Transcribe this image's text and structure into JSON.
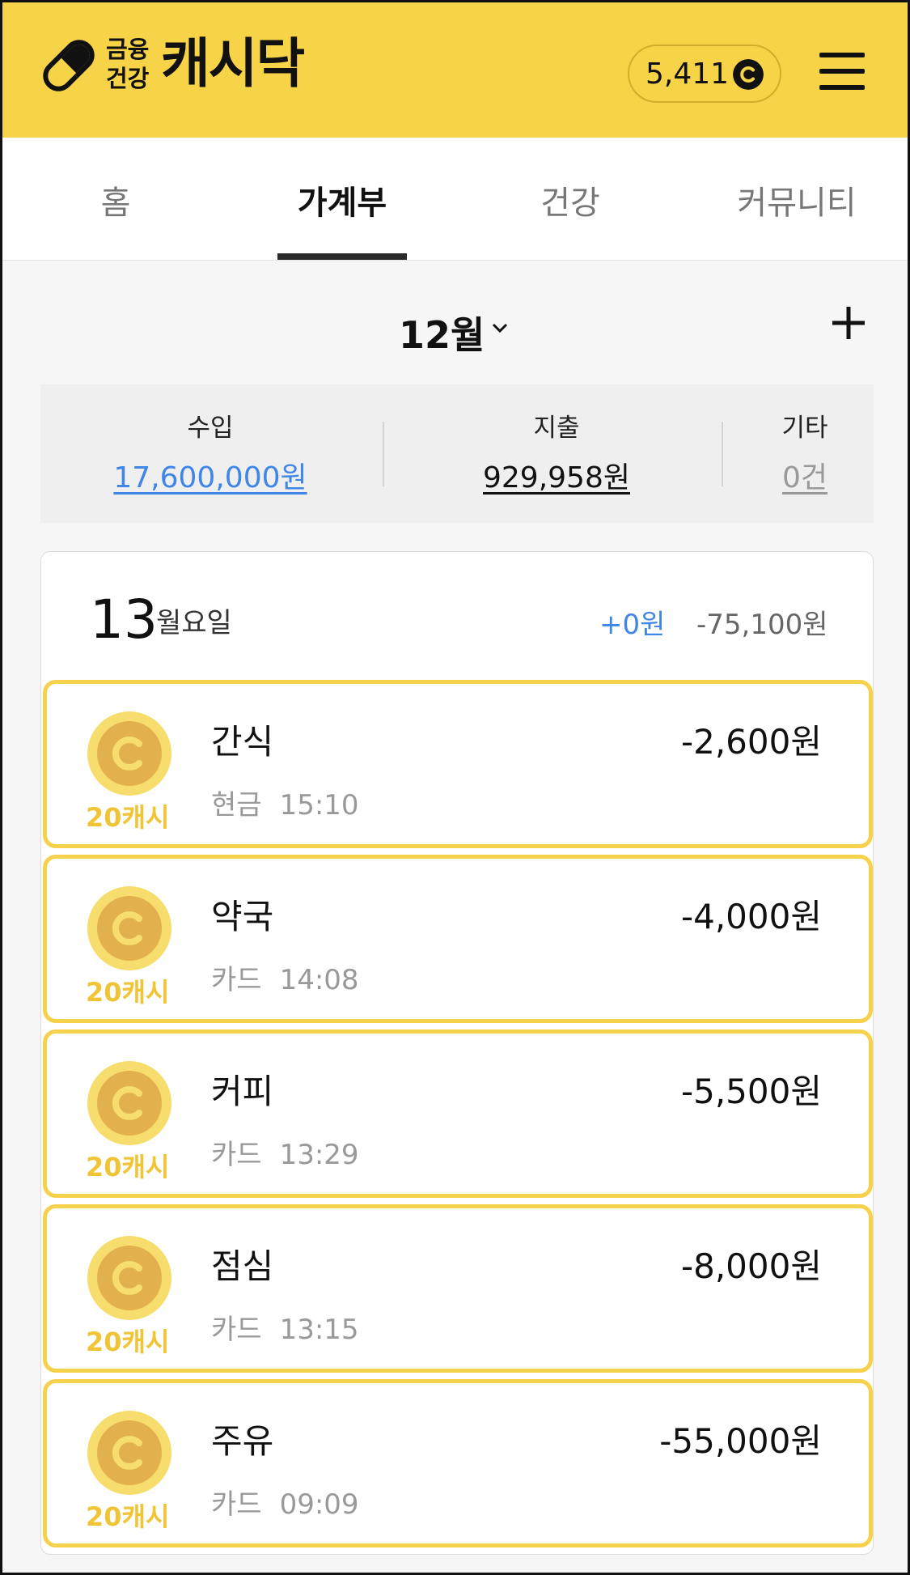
{
  "header": {
    "logo_line1": "금융",
    "logo_line2": "건강",
    "logo_brand": "캐시닥",
    "points": "5,411"
  },
  "tabs": [
    {
      "label": "홈",
      "active": false
    },
    {
      "label": "가계부",
      "active": true
    },
    {
      "label": "건강",
      "active": false
    },
    {
      "label": "커뮤니티",
      "active": false
    }
  ],
  "month": {
    "label": "12월"
  },
  "summary": {
    "income_label": "수입",
    "income_value": "17,600,000원",
    "expense_label": "지출",
    "expense_value": "929,958원",
    "other_label": "기타",
    "other_value": "0건"
  },
  "day": {
    "date": "13",
    "weekday": "월요일",
    "income": "+0원",
    "expense": "-75,100원"
  },
  "transactions": [
    {
      "title": "간식",
      "method": "현금",
      "time": "15:10",
      "amount": "-2,600원",
      "reward": "20캐시"
    },
    {
      "title": "약국",
      "method": "카드",
      "time": "14:08",
      "amount": "-4,000원",
      "reward": "20캐시"
    },
    {
      "title": "커피",
      "method": "카드",
      "time": "13:29",
      "amount": "-5,500원",
      "reward": "20캐시"
    },
    {
      "title": "점심",
      "method": "카드",
      "time": "13:15",
      "amount": "-8,000원",
      "reward": "20캐시"
    },
    {
      "title": "주유",
      "method": "카드",
      "time": "09:09",
      "amount": "-55,000원",
      "reward": "20캐시"
    }
  ],
  "colors": {
    "brand_yellow": "#f7d347",
    "income_blue": "#3f86e6",
    "coin_gold": "#e3b04e",
    "reward_yellow": "#f0c535"
  }
}
